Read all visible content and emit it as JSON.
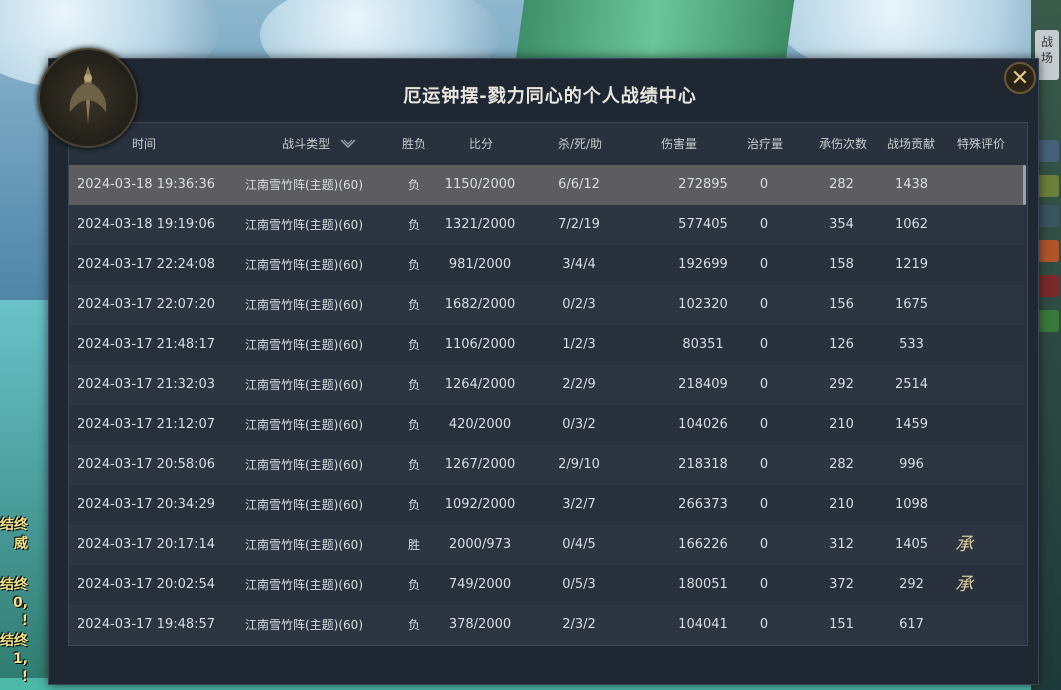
{
  "window": {
    "title": "厄运钟摆-戮力同心的个人战绩中心",
    "close_glyph": "✕"
  },
  "side_tab": {
    "line1": "战",
    "line2": "场"
  },
  "left_edge_text": [
    "结终",
    "威",
    "结终",
    "0,",
    "!",
    "结终",
    "1,",
    "!"
  ],
  "table": {
    "headers": {
      "time": "时间",
      "type": "战斗类型",
      "type_sort_icon": "chevron-down-icon",
      "result": "胜负",
      "score": "比分",
      "kda": "杀/死/助",
      "damage": "伤害量",
      "healing": "治疗量",
      "hits_taken": "承伤次数",
      "contribution": "战场贡献",
      "special": "特殊评价"
    },
    "rows": [
      {
        "time": "2024-03-18 19:36:36",
        "type": "江南雪竹阵(主题)(60)",
        "result": "负",
        "score": "1150/2000",
        "kda": "6/6/12",
        "damage": "272895",
        "healing": "0",
        "hits": "282",
        "contribution": "1438",
        "special": ""
      },
      {
        "time": "2024-03-18 19:19:06",
        "type": "江南雪竹阵(主题)(60)",
        "result": "负",
        "score": "1321/2000",
        "kda": "7/2/19",
        "damage": "577405",
        "healing": "0",
        "hits": "354",
        "contribution": "1062",
        "special": ""
      },
      {
        "time": "2024-03-17 22:24:08",
        "type": "江南雪竹阵(主题)(60)",
        "result": "负",
        "score": "981/2000",
        "kda": "3/4/4",
        "damage": "192699",
        "healing": "0",
        "hits": "158",
        "contribution": "1219",
        "special": ""
      },
      {
        "time": "2024-03-17 22:07:20",
        "type": "江南雪竹阵(主题)(60)",
        "result": "负",
        "score": "1682/2000",
        "kda": "0/2/3",
        "damage": "102320",
        "healing": "0",
        "hits": "156",
        "contribution": "1675",
        "special": ""
      },
      {
        "time": "2024-03-17 21:48:17",
        "type": "江南雪竹阵(主题)(60)",
        "result": "负",
        "score": "1106/2000",
        "kda": "1/2/3",
        "damage": "80351",
        "healing": "0",
        "hits": "126",
        "contribution": "533",
        "special": ""
      },
      {
        "time": "2024-03-17 21:32:03",
        "type": "江南雪竹阵(主题)(60)",
        "result": "负",
        "score": "1264/2000",
        "kda": "2/2/9",
        "damage": "218409",
        "healing": "0",
        "hits": "292",
        "contribution": "2514",
        "special": ""
      },
      {
        "time": "2024-03-17 21:12:07",
        "type": "江南雪竹阵(主题)(60)",
        "result": "负",
        "score": "420/2000",
        "kda": "0/3/2",
        "damage": "104026",
        "healing": "0",
        "hits": "210",
        "contribution": "1459",
        "special": ""
      },
      {
        "time": "2024-03-17 20:58:06",
        "type": "江南雪竹阵(主题)(60)",
        "result": "负",
        "score": "1267/2000",
        "kda": "2/9/10",
        "damage": "218318",
        "healing": "0",
        "hits": "282",
        "contribution": "996",
        "special": ""
      },
      {
        "time": "2024-03-17 20:34:29",
        "type": "江南雪竹阵(主题)(60)",
        "result": "负",
        "score": "1092/2000",
        "kda": "3/2/7",
        "damage": "266373",
        "healing": "0",
        "hits": "210",
        "contribution": "1098",
        "special": ""
      },
      {
        "time": "2024-03-17 20:17:14",
        "type": "江南雪竹阵(主题)(60)",
        "result": "胜",
        "score": "2000/973",
        "kda": "0/4/5",
        "damage": "166226",
        "healing": "0",
        "hits": "312",
        "contribution": "1405",
        "special": "承"
      },
      {
        "time": "2024-03-17 20:02:54",
        "type": "江南雪竹阵(主题)(60)",
        "result": "负",
        "score": "749/2000",
        "kda": "0/5/3",
        "damage": "180051",
        "healing": "0",
        "hits": "372",
        "contribution": "292",
        "special": "承"
      },
      {
        "time": "2024-03-17 19:48:57",
        "type": "江南雪竹阵(主题)(60)",
        "result": "负",
        "score": "378/2000",
        "kda": "2/3/2",
        "damage": "104041",
        "healing": "0",
        "hits": "151",
        "contribution": "617",
        "special": ""
      }
    ]
  },
  "colors": {
    "panel_bg": "#1f2733",
    "table_bg": "#28313d",
    "selected_row": "#5d5d5f",
    "text": "#d9dde2",
    "accent_gold": "#e0c98a"
  }
}
